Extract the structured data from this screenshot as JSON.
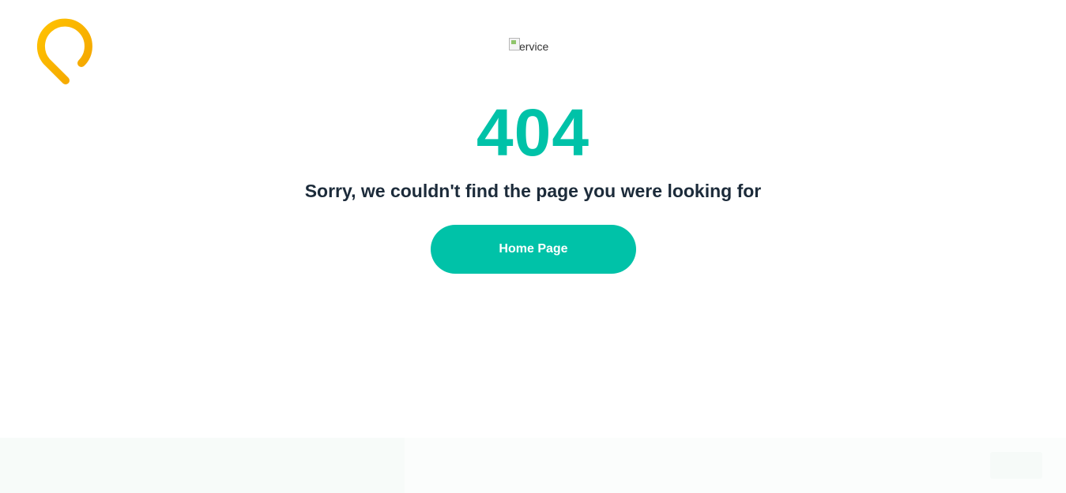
{
  "brand": {
    "logo_icon": "location-pin-ring-icon",
    "logo_color": "#f5b500"
  },
  "hero_image": {
    "alt": "service"
  },
  "error": {
    "code": "404",
    "message": "Sorry, we couldn't find the page you were looking for",
    "accent_color": "#00c2a8",
    "text_color": "#1c2b3a"
  },
  "actions": {
    "home_label": "Home Page"
  },
  "cookie_banner": {
    "text": "",
    "button_label": ""
  }
}
